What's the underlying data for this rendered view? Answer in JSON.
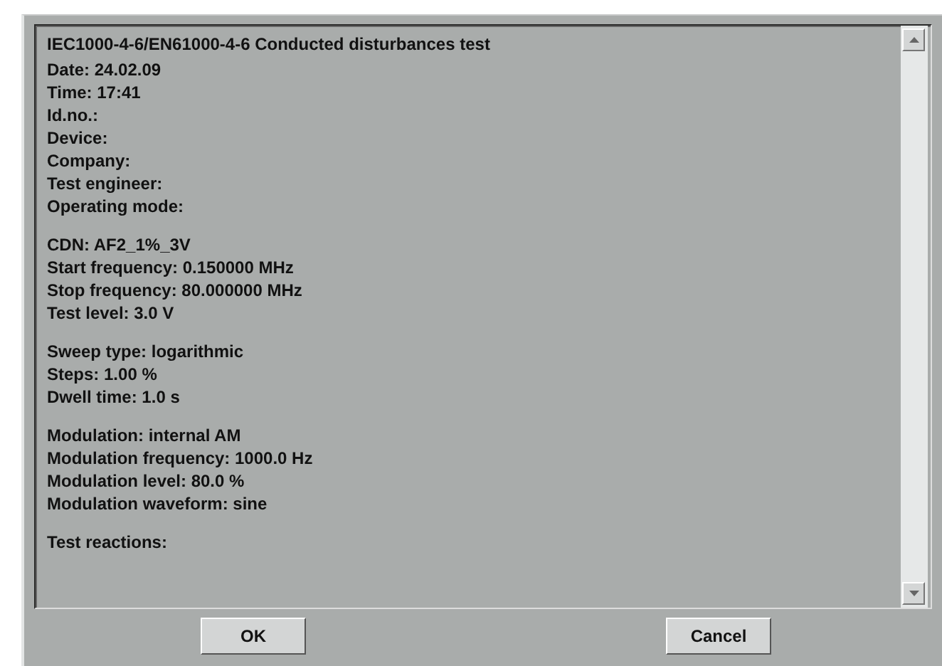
{
  "report": {
    "title": "IEC1000-4-6/EN61000-4-6 Conducted disturbances test",
    "sections": [
      [
        "Date: 24.02.09",
        "Time: 17:41",
        "Id.no.:",
        "Device:",
        "Company:",
        "Test engineer:",
        "Operating mode:"
      ],
      [
        "CDN: AF2_1%_3V",
        "Start frequency: 0.150000 MHz",
        "Stop frequency: 80.000000 MHz",
        "Test level: 3.0 V"
      ],
      [
        "Sweep type: logarithmic",
        "Steps: 1.00 %",
        "Dwell time: 1.0 s"
      ],
      [
        "Modulation: internal AM",
        "Modulation frequency: 1000.0 Hz",
        "Modulation level: 80.0 %",
        "Modulation waveform: sine"
      ],
      [
        "Test reactions:"
      ]
    ]
  },
  "buttons": [
    {
      "label": "OK"
    },
    {
      "label": "Cancel"
    }
  ]
}
